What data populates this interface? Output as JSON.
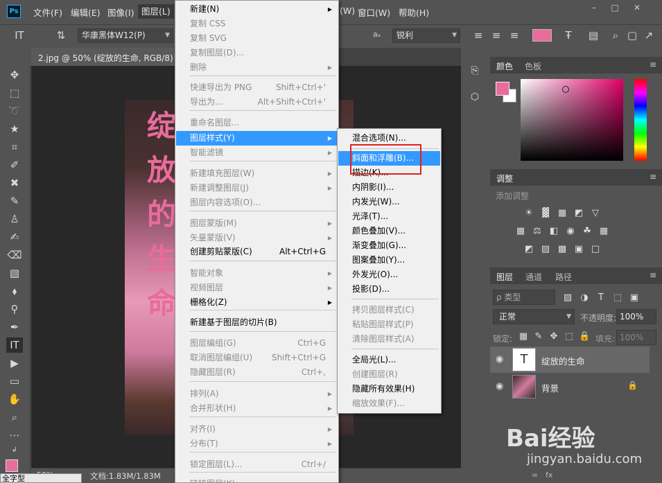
{
  "app": {
    "logo": "Ps"
  },
  "menubar": {
    "items": [
      "文件(F)",
      "编辑(E)",
      "图像(I)",
      "图层(L)"
    ],
    "items_right": [
      "(W)",
      "窗口(W)",
      "帮助(H)"
    ]
  },
  "options": {
    "font_family": "华康黑体W12(P)",
    "aa_label": "aₐ",
    "antialias": "锐利",
    "text_color": "#e86c9c"
  },
  "document": {
    "tab_title": "2.jpg @ 50% (绽放的生命, RGB/8) *",
    "canvas_text": "绽放的生命",
    "zoom": "50%",
    "doc_info": "文档:1.83M/1.83M"
  },
  "ime": {
    "label": "全字型"
  },
  "layer_menu": {
    "items": [
      {
        "label": "新建(N)",
        "shortcut": "",
        "sub": true,
        "disabled": false
      },
      {
        "label": "复制 CSS",
        "shortcut": "",
        "sub": false,
        "disabled": true
      },
      {
        "label": "复制 SVG",
        "shortcut": "",
        "sub": false,
        "disabled": true
      },
      {
        "label": "复制图层(D)...",
        "shortcut": "",
        "sub": false,
        "disabled": true
      },
      {
        "label": "删除",
        "shortcut": "",
        "sub": true,
        "disabled": true
      },
      {
        "label": "快速导出为 PNG",
        "shortcut": "Shift+Ctrl+'",
        "sub": false,
        "disabled": true
      },
      {
        "label": "导出为...",
        "shortcut": "Alt+Shift+Ctrl+'",
        "sub": false,
        "disabled": true
      },
      {
        "label": "重命名图层...",
        "shortcut": "",
        "sub": false,
        "disabled": true
      },
      {
        "label": "图层样式(Y)",
        "shortcut": "",
        "sub": true,
        "disabled": false,
        "highlight": true
      },
      {
        "label": "智能滤镜",
        "shortcut": "",
        "sub": true,
        "disabled": true
      },
      {
        "label": "新建填充图层(W)",
        "shortcut": "",
        "sub": true,
        "disabled": true
      },
      {
        "label": "新建调整图层(J)",
        "shortcut": "",
        "sub": true,
        "disabled": true
      },
      {
        "label": "图层内容选项(O)...",
        "shortcut": "",
        "sub": false,
        "disabled": true
      },
      {
        "label": "图层蒙版(M)",
        "shortcut": "",
        "sub": true,
        "disabled": true
      },
      {
        "label": "矢量蒙版(V)",
        "shortcut": "",
        "sub": true,
        "disabled": true
      },
      {
        "label": "创建剪贴蒙版(C)",
        "shortcut": "Alt+Ctrl+G",
        "sub": false,
        "disabled": false
      },
      {
        "label": "智能对象",
        "shortcut": "",
        "sub": true,
        "disabled": true
      },
      {
        "label": "视频图层",
        "shortcut": "",
        "sub": true,
        "disabled": true
      },
      {
        "label": "栅格化(Z)",
        "shortcut": "",
        "sub": true,
        "disabled": false
      },
      {
        "label": "新建基于图层的切片(B)",
        "shortcut": "",
        "sub": false,
        "disabled": false
      },
      {
        "label": "图层编组(G)",
        "shortcut": "Ctrl+G",
        "sub": false,
        "disabled": true
      },
      {
        "label": "取消图层编组(U)",
        "shortcut": "Shift+Ctrl+G",
        "sub": false,
        "disabled": true
      },
      {
        "label": "隐藏图层(R)",
        "shortcut": "Ctrl+,",
        "sub": false,
        "disabled": true
      },
      {
        "label": "排列(A)",
        "shortcut": "",
        "sub": true,
        "disabled": true
      },
      {
        "label": "合并形状(H)",
        "shortcut": "",
        "sub": true,
        "disabled": true
      },
      {
        "label": "对齐(I)",
        "shortcut": "",
        "sub": true,
        "disabled": true
      },
      {
        "label": "分布(T)",
        "shortcut": "",
        "sub": true,
        "disabled": true
      },
      {
        "label": "锁定图层(L)...",
        "shortcut": "Ctrl+/",
        "sub": false,
        "disabled": true
      },
      {
        "label": "链接图层(K)",
        "shortcut": "",
        "sub": false,
        "disabled": true
      }
    ]
  },
  "style_submenu": {
    "items": [
      {
        "label": "混合选项(N)...",
        "disabled": false
      },
      {
        "label": "斜面和浮雕(B)...",
        "disabled": false,
        "highlight": true
      },
      {
        "label": "描边(K)...",
        "disabled": false
      },
      {
        "label": "内阴影(I)...",
        "disabled": false
      },
      {
        "label": "内发光(W)...",
        "disabled": false
      },
      {
        "label": "光泽(T)...",
        "disabled": false
      },
      {
        "label": "颜色叠加(V)...",
        "disabled": false
      },
      {
        "label": "渐变叠加(G)...",
        "disabled": false
      },
      {
        "label": "图案叠加(Y)...",
        "disabled": false
      },
      {
        "label": "外发光(O)...",
        "disabled": false
      },
      {
        "label": "投影(D)...",
        "disabled": false
      },
      {
        "label": "拷贝图层样式(C)",
        "disabled": true
      },
      {
        "label": "粘贴图层样式(P)",
        "disabled": true
      },
      {
        "label": "清除图层样式(A)",
        "disabled": true
      },
      {
        "label": "全局光(L)...",
        "disabled": false
      },
      {
        "label": "创建图层(R)",
        "disabled": true
      },
      {
        "label": "隐藏所有效果(H)",
        "disabled": false
      },
      {
        "label": "缩放效果(F)...",
        "disabled": true
      }
    ]
  },
  "color_panel": {
    "tabs": [
      "颜色",
      "色板"
    ],
    "fg": "#e86c9c",
    "bg": "#ffffff"
  },
  "adjust_panel": {
    "title": "调整",
    "subtitle": "添加调整"
  },
  "layers_panel": {
    "tabs": [
      "图层",
      "通道",
      "路径"
    ],
    "search": "ρ 类型",
    "blend_mode": "正常",
    "opacity_label": "不透明度:",
    "opacity": "100%",
    "lock_label": "锁定:",
    "fill_label": "填充:",
    "fill": "100%",
    "layers": [
      {
        "name": "绽放的生命",
        "thumb": "T",
        "selected": true
      },
      {
        "name": "背景",
        "thumb": "",
        "selected": false
      }
    ],
    "bottom_icons": "fx"
  },
  "watermark": {
    "brand": "Bai经验",
    "url": "jingyan.baidu.com"
  }
}
